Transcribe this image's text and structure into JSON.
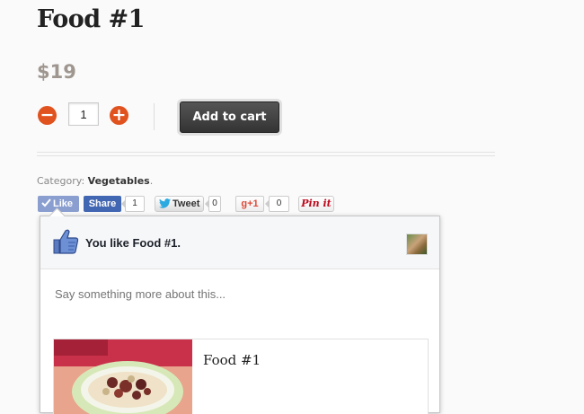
{
  "product": {
    "title": "Food #1",
    "price": "$19",
    "quantity": "1",
    "minus_symbol": "−",
    "plus_symbol": "+",
    "add_to_cart_label": "Add to cart"
  },
  "meta": {
    "category_label": "Category:",
    "category_value": "Vegetables",
    "category_suffix": "."
  },
  "social": {
    "like_label": "Like",
    "share_label": "Share",
    "share_count": "1",
    "tweet_label": "Tweet",
    "tweet_count": "0",
    "gplus_label": "g+1",
    "gplus_count": "0",
    "pinit_label": "Pin it"
  },
  "fb_popup": {
    "title": "You like Food #1.",
    "comment_placeholder": "Say something more about this...",
    "preview_title": "Food #1"
  },
  "colors": {
    "qty_button": "#e0521e",
    "cart_button": "#3b3b3b",
    "facebook_blue": "#4267b2",
    "facebook_like_active": "#8a9ed0",
    "price_gray": "#9e968f"
  },
  "icons": {
    "minus": "minus-circle-icon",
    "plus": "plus-circle-icon",
    "like_check": "check-icon",
    "twitter": "twitter-bird-icon",
    "thumbs_up": "thumbs-up-icon"
  }
}
